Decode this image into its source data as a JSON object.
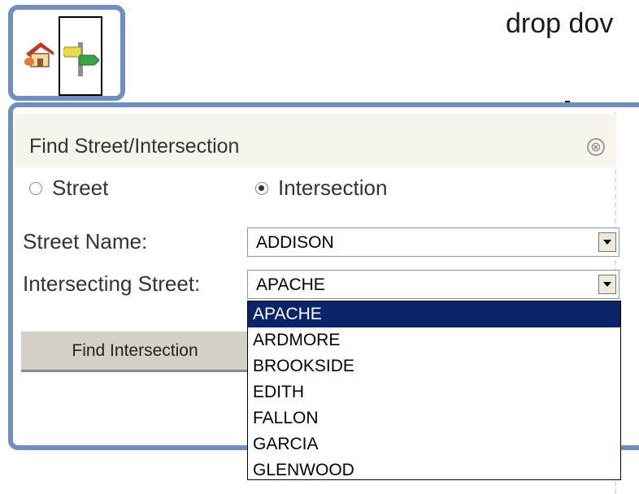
{
  "caption": "drop dov",
  "toolbar": {
    "home_icon": "house-icon",
    "sign_icon": "signpost-icon"
  },
  "panel": {
    "title": "Find Street/Intersection",
    "close_icon": "close-circle-icon",
    "radio_street_label": "Street",
    "radio_intersection_label": "Intersection",
    "selected_radio": "Intersection",
    "street_name_label": "Street Name:",
    "street_name_value": "ADDISON",
    "intersecting_label": "Intersecting Street:",
    "intersecting_value": "APACHE",
    "find_button_label": "Find Intersection"
  },
  "dropdown": {
    "options": [
      "APACHE",
      "ARDMORE",
      "BROOKSIDE",
      "EDITH",
      "FALLON",
      "GARCIA",
      "GLENWOOD"
    ],
    "selected_index": 0
  },
  "colors": {
    "frame_blue": "#6f8fc0",
    "selection_navy": "#0a246a",
    "header_bg": "#f6f4ec",
    "button_bg": "#d4d0c8"
  }
}
